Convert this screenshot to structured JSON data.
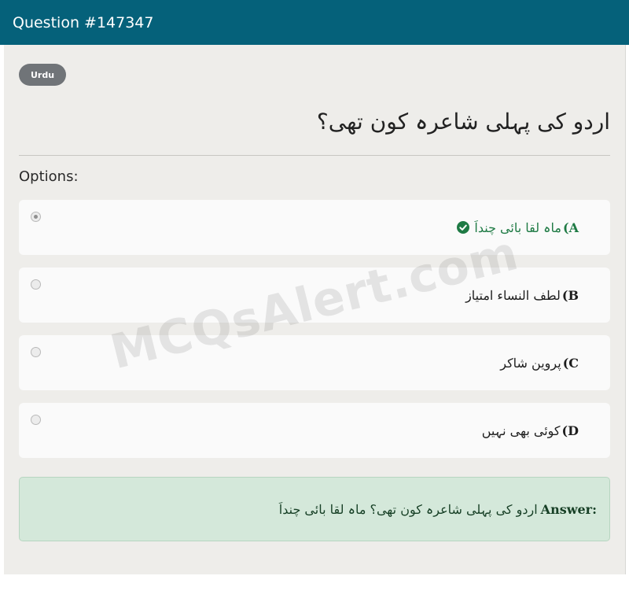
{
  "header": {
    "title": "Question #147347"
  },
  "tag": {
    "label": "Urdu"
  },
  "question": {
    "text": "اردو کی پہلی شاعرہ کون تھی؟"
  },
  "options_label": "Options:",
  "options": [
    {
      "letter": "A)",
      "text": "ماہ لقا بائی چنداَ",
      "selected": true,
      "correct": true
    },
    {
      "letter": "B)",
      "text": "لطف النساء امتیاز",
      "selected": false,
      "correct": false
    },
    {
      "letter": "C)",
      "text": "پروین شاکر",
      "selected": false,
      "correct": false
    },
    {
      "letter": "D)",
      "text": "کوئی بھی نہیں",
      "selected": false,
      "correct": false
    }
  ],
  "answer": {
    "label": "Answer:",
    "text": "اردو کی پہلی شاعرہ کون تھی؟ ماہ لقا بائی چنداَ"
  },
  "watermark": "MCQsAlert.com",
  "colors": {
    "header_bg": "#05617a",
    "correct": "#1e7a44",
    "answer_bg": "#d4e8da"
  },
  "icons": {
    "correct": "check-circle-icon"
  }
}
